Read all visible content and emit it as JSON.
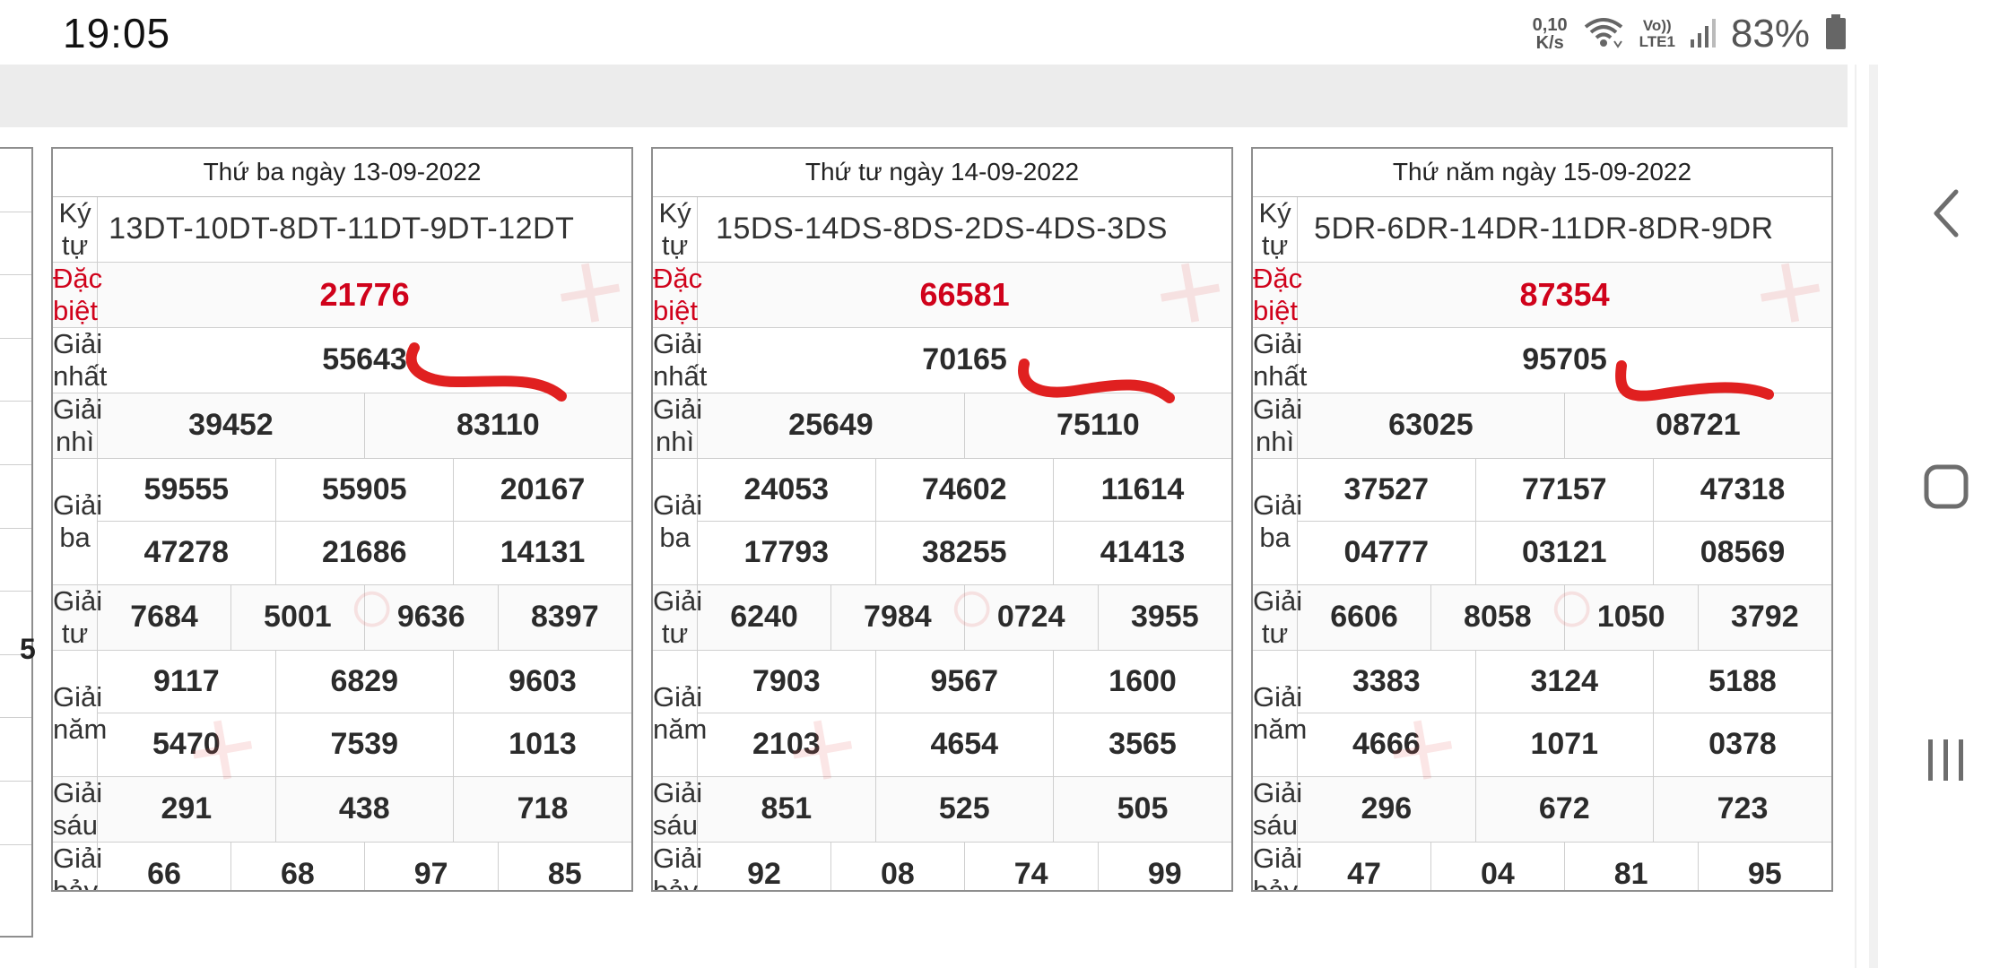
{
  "status": {
    "time": "19:05",
    "net_speed_value": "0,10",
    "net_speed_unit": "K/s",
    "volte_top": "Vo))",
    "volte_bottom": "LTE1",
    "battery": "83%"
  },
  "labels": {
    "ky_tu": "Ký tự",
    "dac_biet": "Đặc biệt",
    "giai_nhat": "Giải nhất",
    "giai_nhi": "Giải nhì",
    "giai_ba": "Giải ba",
    "giai_tu": "Giải tư",
    "giai_nam": "Giải năm",
    "giai_sau": "Giải sáu",
    "giai_bay": "Giải bảy"
  },
  "partial_table": {
    "digit": "5"
  },
  "tables": [
    {
      "title": "Thứ ba ngày 13-09-2022",
      "ky_tu": "13DT-10DT-8DT-11DT-9DT-12DT",
      "dac_biet": "21776",
      "giai_nhat": "55643",
      "giai_nhi": [
        "39452",
        "83110"
      ],
      "giai_ba": [
        "59555",
        "55905",
        "20167",
        "47278",
        "21686",
        "14131"
      ],
      "giai_tu": [
        "7684",
        "5001",
        "9636",
        "8397"
      ],
      "giai_nam": [
        "9117",
        "6829",
        "9603",
        "5470",
        "7539",
        "1013"
      ],
      "giai_sau": [
        "291",
        "438",
        "718"
      ],
      "giai_bay": [
        "66",
        "68",
        "97",
        "85"
      ]
    },
    {
      "title": "Thứ tư ngày 14-09-2022",
      "ky_tu": "15DS-14DS-8DS-2DS-4DS-3DS",
      "dac_biet": "66581",
      "giai_nhat": "70165",
      "giai_nhi": [
        "25649",
        "75110"
      ],
      "giai_ba": [
        "24053",
        "74602",
        "11614",
        "17793",
        "38255",
        "41413"
      ],
      "giai_tu": [
        "6240",
        "7984",
        "0724",
        "3955"
      ],
      "giai_nam": [
        "7903",
        "9567",
        "1600",
        "2103",
        "4654",
        "3565"
      ],
      "giai_sau": [
        "851",
        "525",
        "505"
      ],
      "giai_bay": [
        "92",
        "08",
        "74",
        "99"
      ]
    },
    {
      "title": "Thứ năm ngày 15-09-2022",
      "ky_tu": "5DR-6DR-14DR-11DR-8DR-9DR",
      "dac_biet": "87354",
      "giai_nhat": "95705",
      "giai_nhi": [
        "63025",
        "08721"
      ],
      "giai_ba": [
        "37527",
        "77157",
        "47318",
        "04777",
        "03121",
        "08569"
      ],
      "giai_tu": [
        "6606",
        "8058",
        "1050",
        "3792"
      ],
      "giai_nam": [
        "3383",
        "3124",
        "5188",
        "4666",
        "1071",
        "0378"
      ],
      "giai_sau": [
        "296",
        "672",
        "723"
      ],
      "giai_bay": [
        "47",
        "04",
        "81",
        "95"
      ]
    }
  ],
  "colors": {
    "accent_red": "#d0021b",
    "scribble_red": "#e02020"
  },
  "icons": [
    "wifi-icon",
    "signal-icon",
    "battery-icon",
    "back-icon",
    "home-icon",
    "recent-apps-icon"
  ]
}
